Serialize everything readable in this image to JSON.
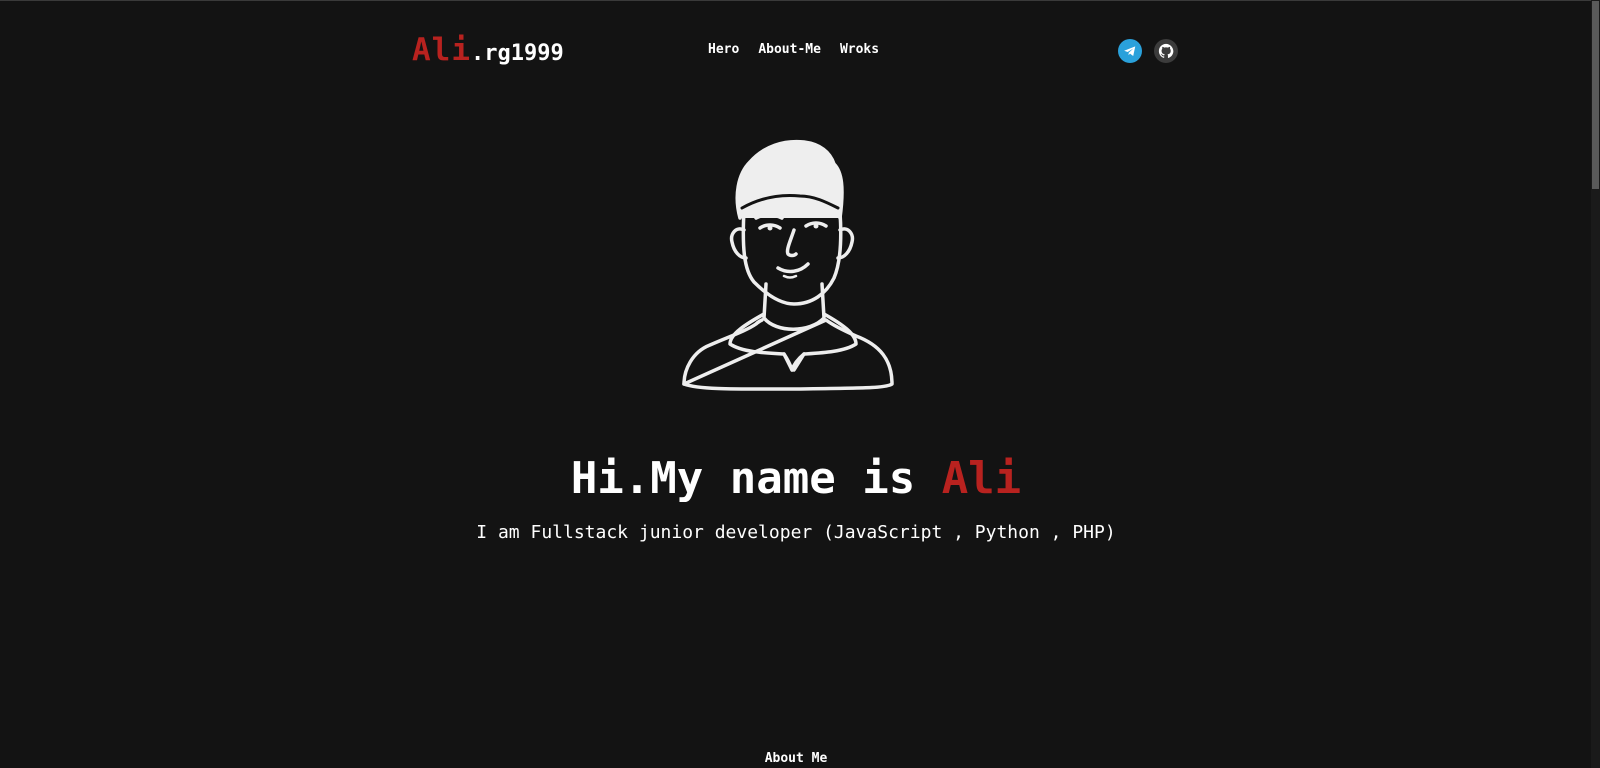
{
  "header": {
    "logo": {
      "highlight": "Ali",
      "rest": ".rg1999"
    },
    "nav": [
      {
        "label": "Hero"
      },
      {
        "label": "About-Me"
      },
      {
        "label": "Wroks"
      }
    ],
    "social": [
      {
        "icon": "telegram-icon",
        "color": "#2aa1db"
      },
      {
        "icon": "github-icon",
        "color": "#3c3c3c"
      }
    ]
  },
  "hero": {
    "avatar_icon": "avatar-illustration",
    "title_prefix": "Hi.My name is ",
    "title_name": "Ali",
    "subtitle": "I am Fullstack junior developer (JavaScript , Python , PHP)"
  },
  "about": {
    "heading": "About Me"
  },
  "colors": {
    "background": "#131313",
    "accent": "#b8221f",
    "text": "#ffffff"
  }
}
